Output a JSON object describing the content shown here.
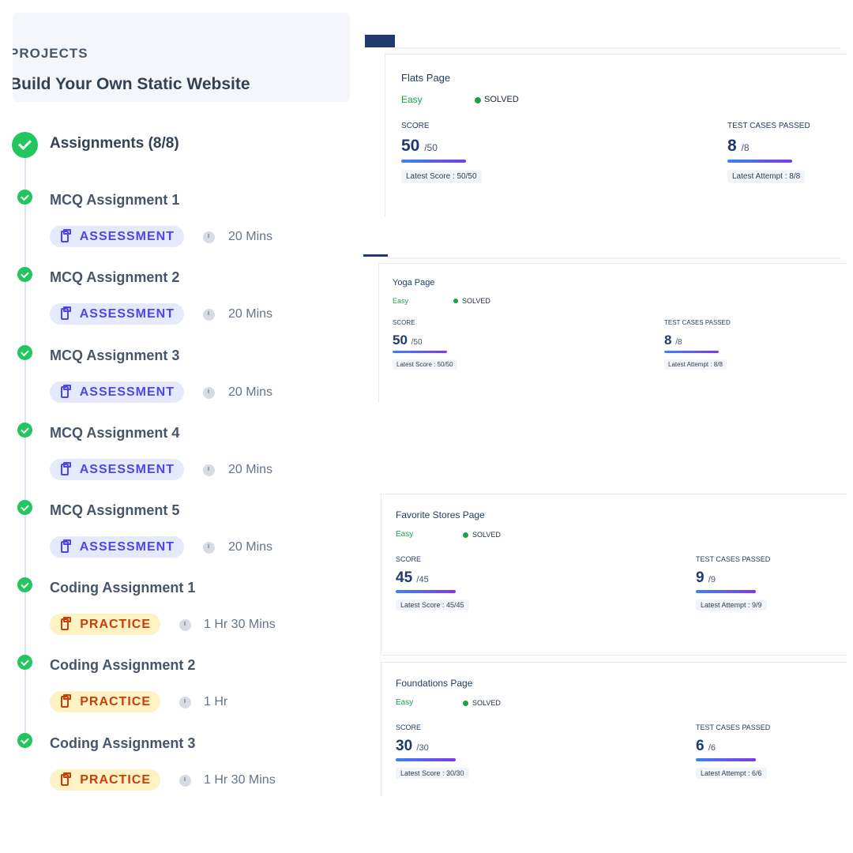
{
  "project": {
    "category": "PROJECTS",
    "title": "Build Your Own Static Website"
  },
  "assignments": {
    "heading": "Assignments (8/8)",
    "items": [
      {
        "title": "MCQ Assignment 1",
        "tag": "ASSESSMENT",
        "duration": "20 Mins"
      },
      {
        "title": "MCQ Assignment 2",
        "tag": "ASSESSMENT",
        "duration": "20 Mins"
      },
      {
        "title": "MCQ Assignment 3",
        "tag": "ASSESSMENT",
        "duration": "20 Mins"
      },
      {
        "title": "MCQ Assignment 4",
        "tag": "ASSESSMENT",
        "duration": "20 Mins"
      },
      {
        "title": "MCQ Assignment 5",
        "tag": "ASSESSMENT",
        "duration": "20 Mins"
      },
      {
        "title": "Coding Assignment 1",
        "tag": "PRACTICE",
        "duration": "1 Hr 30 Mins"
      },
      {
        "title": "Coding Assignment 2",
        "tag": "PRACTICE",
        "duration": "1 Hr"
      },
      {
        "title": "Coding Assignment 3",
        "tag": "PRACTICE",
        "duration": "1 Hr 30 Mins"
      }
    ]
  },
  "cards": [
    {
      "title": "Flats Page",
      "difficulty": "Easy",
      "status": "SOLVED",
      "score_label": "SCORE",
      "score": "50",
      "score_max": "/50",
      "latest_score": "Latest Score : 50/50",
      "tests_label": "TEST CASES PASSED",
      "tests": "8",
      "tests_max": "/8",
      "latest_attempt": "Latest Attempt : 8/8"
    },
    {
      "title": "Yoga Page",
      "difficulty": "Easy",
      "status": "SOLVED",
      "score_label": "SCORE",
      "score": "50",
      "score_max": "/50",
      "latest_score": "Latest Score : 50/50",
      "tests_label": "TEST CASES PASSED",
      "tests": "8",
      "tests_max": "/8",
      "latest_attempt": "Latest Attempt : 8/8"
    },
    {
      "title": "Favorite Stores Page",
      "difficulty": "Easy",
      "status": "SOLVED",
      "score_label": "SCORE",
      "score": "45",
      "score_max": "/45",
      "latest_score": "Latest Score : 45/45",
      "tests_label": "TEST CASES PASSED",
      "tests": "9",
      "tests_max": "/9",
      "latest_attempt": "Latest Attempt : 9/9"
    },
    {
      "title": "Foundations Page",
      "difficulty": "Easy",
      "status": "SOLVED",
      "score_label": "SCORE",
      "score": "30",
      "score_max": "/30",
      "latest_score": "Latest Score : 30/30",
      "tests_label": "TEST CASES PASSED",
      "tests": "6",
      "tests_max": "/6",
      "latest_attempt": "Latest Attempt : 6/6"
    }
  ],
  "colors": {
    "success": "#22c55e",
    "assessment_bg": "#e5e9fc",
    "assessment_text": "#4f46e5",
    "practice_bg": "#fdf2c4",
    "practice_text": "#c2410c",
    "score_bar_start": "#3b82f6",
    "score_bar_end": "#7c3aed"
  }
}
